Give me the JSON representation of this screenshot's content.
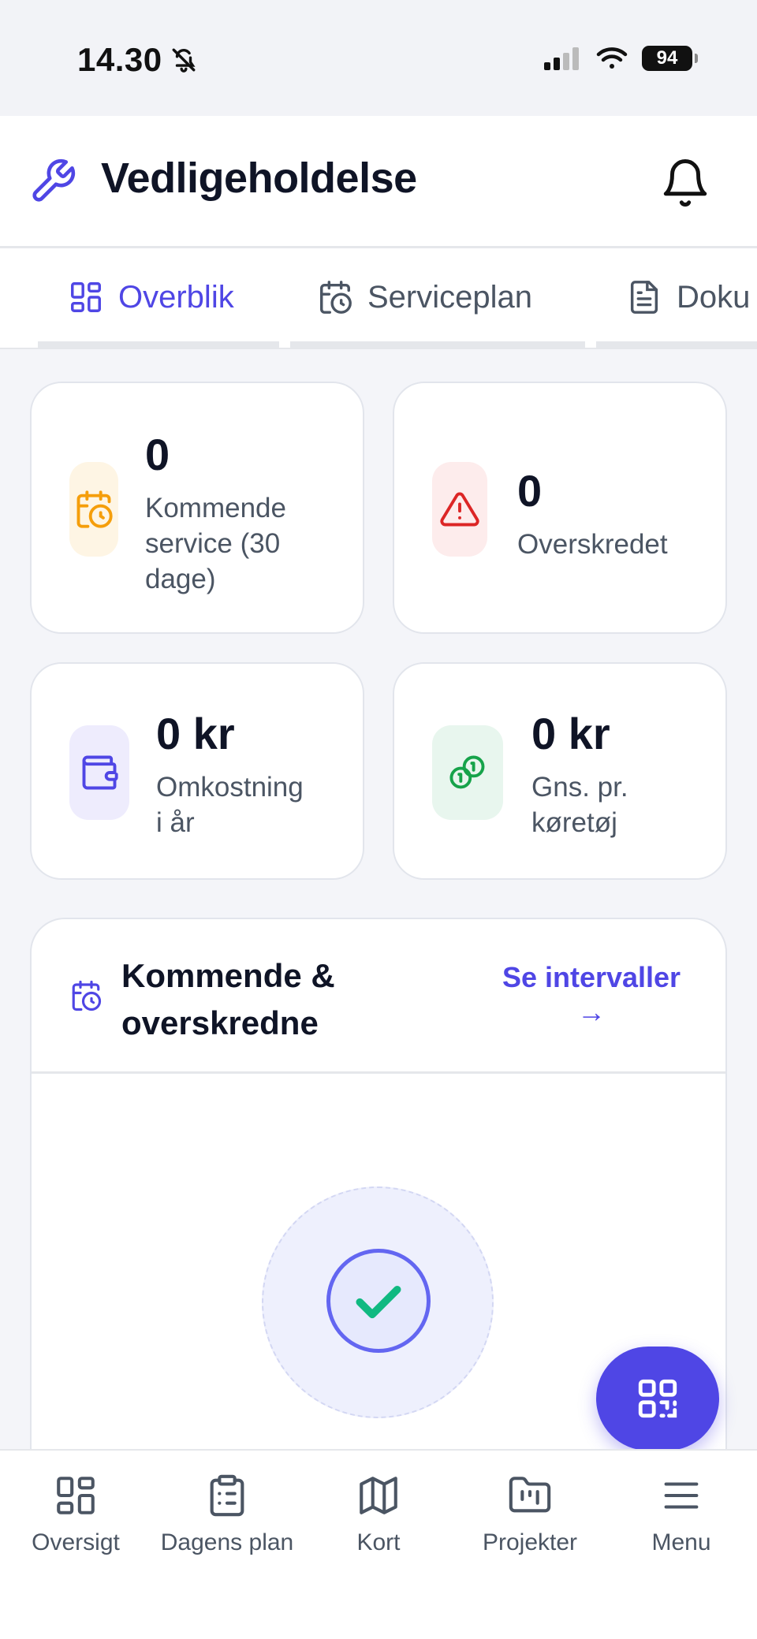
{
  "status_bar": {
    "time": "14.30",
    "battery": "94"
  },
  "header": {
    "title": "Vedligeholdelse"
  },
  "tabs": [
    {
      "label": "Overblik",
      "active": true
    },
    {
      "label": "Serviceplan",
      "active": false
    },
    {
      "label": "Doku",
      "active": false
    }
  ],
  "stats": {
    "upcoming": {
      "value": "0",
      "label_lines": [
        "Kommende",
        "service (30",
        "dage)"
      ]
    },
    "overdue": {
      "value": "0",
      "label": "Overskredet"
    },
    "cost": {
      "value": "0 kr",
      "label_lines": [
        "Omkostning",
        "i år"
      ]
    },
    "avg": {
      "value": "0 kr",
      "label_lines": [
        "Gns. pr.",
        "køretøj"
      ]
    }
  },
  "section": {
    "title_lines": [
      "Kommende &",
      "overskredne"
    ],
    "link_label": "Se intervaller",
    "link_arrow": "→"
  },
  "bottom_nav": [
    {
      "label": "Oversigt"
    },
    {
      "label": "Dagens plan"
    },
    {
      "label": "Kort"
    },
    {
      "label": "Projekter"
    },
    {
      "label": "Menu"
    }
  ],
  "colors": {
    "accent": "#4f46e5",
    "warning": "#f59e0b",
    "danger": "#dc2626",
    "success": "#16a34a"
  }
}
